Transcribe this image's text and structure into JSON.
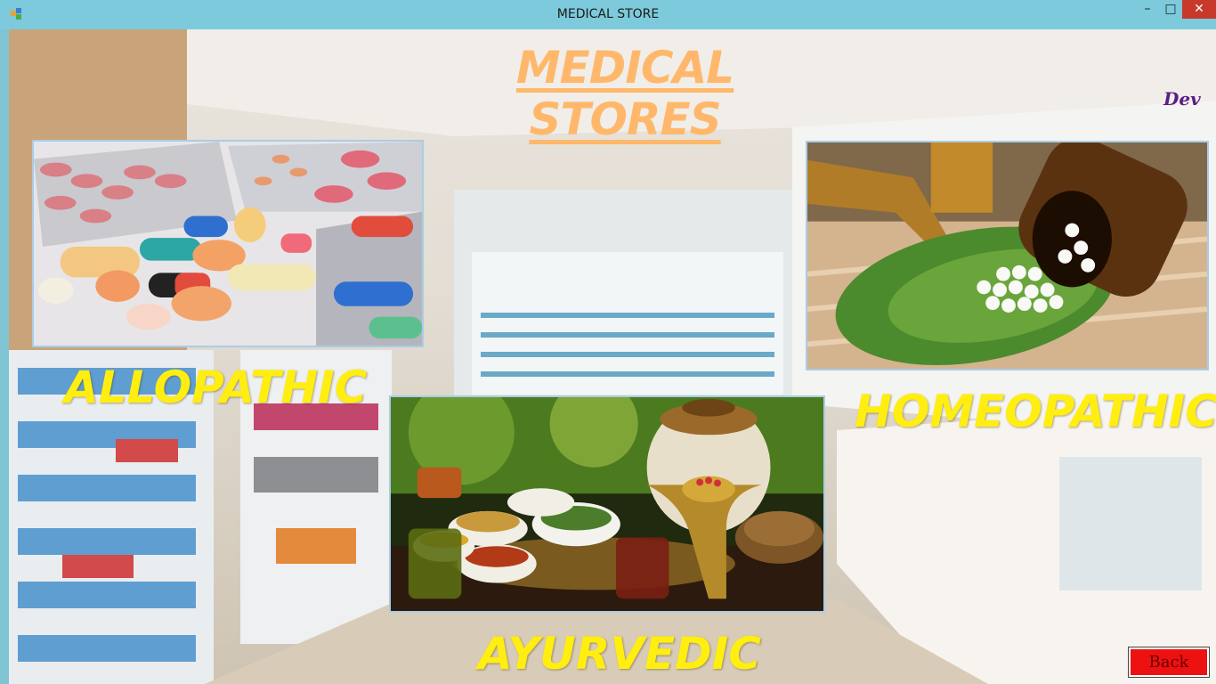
{
  "window": {
    "title": "MEDICAL STORE",
    "minimize_glyph": "–",
    "maximize_glyph": "□",
    "close_glyph": "✕"
  },
  "main": {
    "heading": "MEDICAL STORES",
    "author": "Dev",
    "categories": [
      {
        "id": "allopathic",
        "label": "ALLOPATHIC"
      },
      {
        "id": "homeopathic",
        "label": "HOMEOPATHIC"
      },
      {
        "id": "ayurvedic",
        "label": "AYURVEDIC"
      }
    ],
    "back_label": "Back"
  },
  "colors": {
    "titlebar": "#7ccadb",
    "heading": "#ffb86b",
    "labels": "#ffee10",
    "author": "#5a1e86",
    "back_button": "#ee1111"
  }
}
